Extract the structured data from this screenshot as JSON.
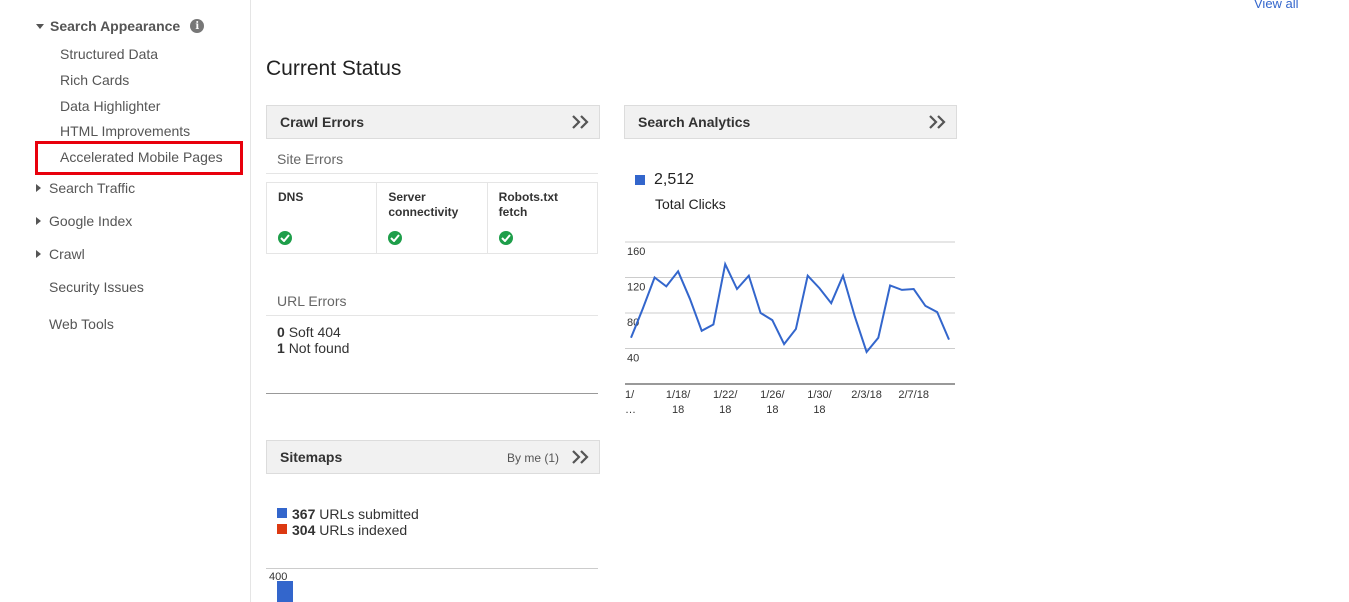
{
  "sidebar": {
    "section_title": "Search Appearance",
    "sub_items": [
      "Structured Data",
      "Rich Cards",
      "Data Highlighter",
      "HTML Improvements",
      "Accelerated Mobile Pages"
    ],
    "top_items": [
      "Search Traffic",
      "Google Index",
      "Crawl"
    ],
    "plain_items": [
      "Security Issues",
      "Web Tools"
    ]
  },
  "header": {
    "view_all": "View all"
  },
  "main": {
    "title": "Current Status"
  },
  "crawl_errors": {
    "title": "Crawl Errors",
    "site_errors_label": "Site Errors",
    "columns": [
      {
        "line1": "DNS",
        "line2": ""
      },
      {
        "line1": "Server",
        "line2": "connectivity"
      },
      {
        "line1": "Robots.txt fetch",
        "line2": ""
      }
    ],
    "url_errors_label": "URL Errors",
    "url_errors": [
      {
        "count": "0",
        "label": "Soft 404"
      },
      {
        "count": "1",
        "label": "Not found"
      }
    ]
  },
  "sitemaps": {
    "title": "Sitemaps",
    "filter_label": "By me (1)",
    "submitted_count": "367",
    "submitted_label": "URLs submitted",
    "indexed_count": "304",
    "indexed_label": "URLs indexed",
    "axis_top": "400",
    "submitted_color": "#3366cc",
    "indexed_color": "#dc3912"
  },
  "search_analytics": {
    "title": "Search Analytics",
    "total_value": "2,512",
    "total_label": "Total Clicks",
    "color": "#3366cc"
  },
  "chart_data": {
    "type": "line",
    "ylim": [
      0,
      160
    ],
    "y_ticks": [
      "160",
      "120",
      "80",
      "40"
    ],
    "x_tick_labels": [
      [
        "1/",
        "…"
      ],
      [
        "1/18/",
        "18"
      ],
      [
        "1/22/",
        "18"
      ],
      [
        "1/26/",
        "18"
      ],
      [
        "1/30/",
        "18"
      ],
      [
        "2/3/18",
        ""
      ],
      [
        "2/7/18",
        ""
      ]
    ],
    "series": [
      {
        "values": [
          52,
          85,
          120,
          110,
          127,
          96,
          60,
          67,
          135,
          107,
          122,
          80,
          72,
          45,
          62,
          122,
          108,
          91,
          122,
          76,
          36,
          52,
          111,
          106,
          107,
          88,
          81,
          50
        ]
      }
    ]
  }
}
